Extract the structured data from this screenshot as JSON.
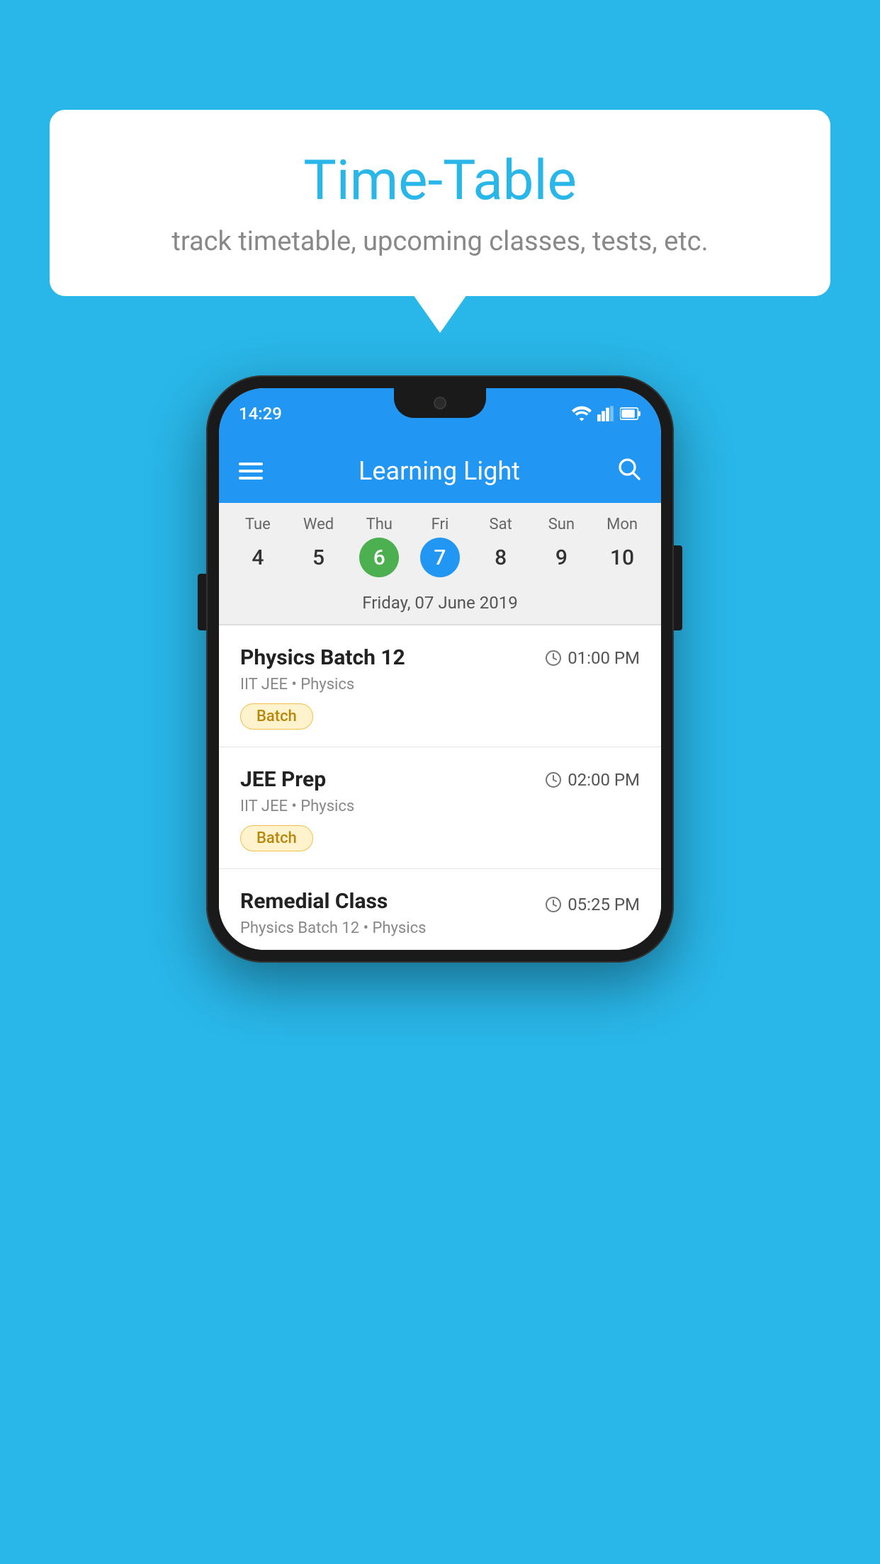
{
  "background_color": "#29b6e8",
  "speech_bubble": {
    "title": "Time-Table",
    "subtitle": "track timetable, upcoming classes, tests, etc."
  },
  "phone": {
    "status_bar": {
      "time": "14:29"
    },
    "app_bar": {
      "title": "Learning Light"
    },
    "calendar": {
      "days": [
        {
          "name": "Tue",
          "num": "4",
          "state": "normal"
        },
        {
          "name": "Wed",
          "num": "5",
          "state": "normal"
        },
        {
          "name": "Thu",
          "num": "6",
          "state": "today"
        },
        {
          "name": "Fri",
          "num": "7",
          "state": "selected"
        },
        {
          "name": "Sat",
          "num": "8",
          "state": "normal"
        },
        {
          "name": "Sun",
          "num": "9",
          "state": "normal"
        },
        {
          "name": "Mon",
          "num": "10",
          "state": "normal"
        }
      ],
      "selected_date_label": "Friday, 07 June 2019"
    },
    "schedule": [
      {
        "title": "Physics Batch 12",
        "time": "01:00 PM",
        "sub": "IIT JEE • Physics",
        "tag": "Batch"
      },
      {
        "title": "JEE Prep",
        "time": "02:00 PM",
        "sub": "IIT JEE • Physics",
        "tag": "Batch"
      },
      {
        "title": "Remedial Class",
        "time": "05:25 PM",
        "sub": "Physics Batch 12 • Physics",
        "tag": null
      }
    ]
  }
}
